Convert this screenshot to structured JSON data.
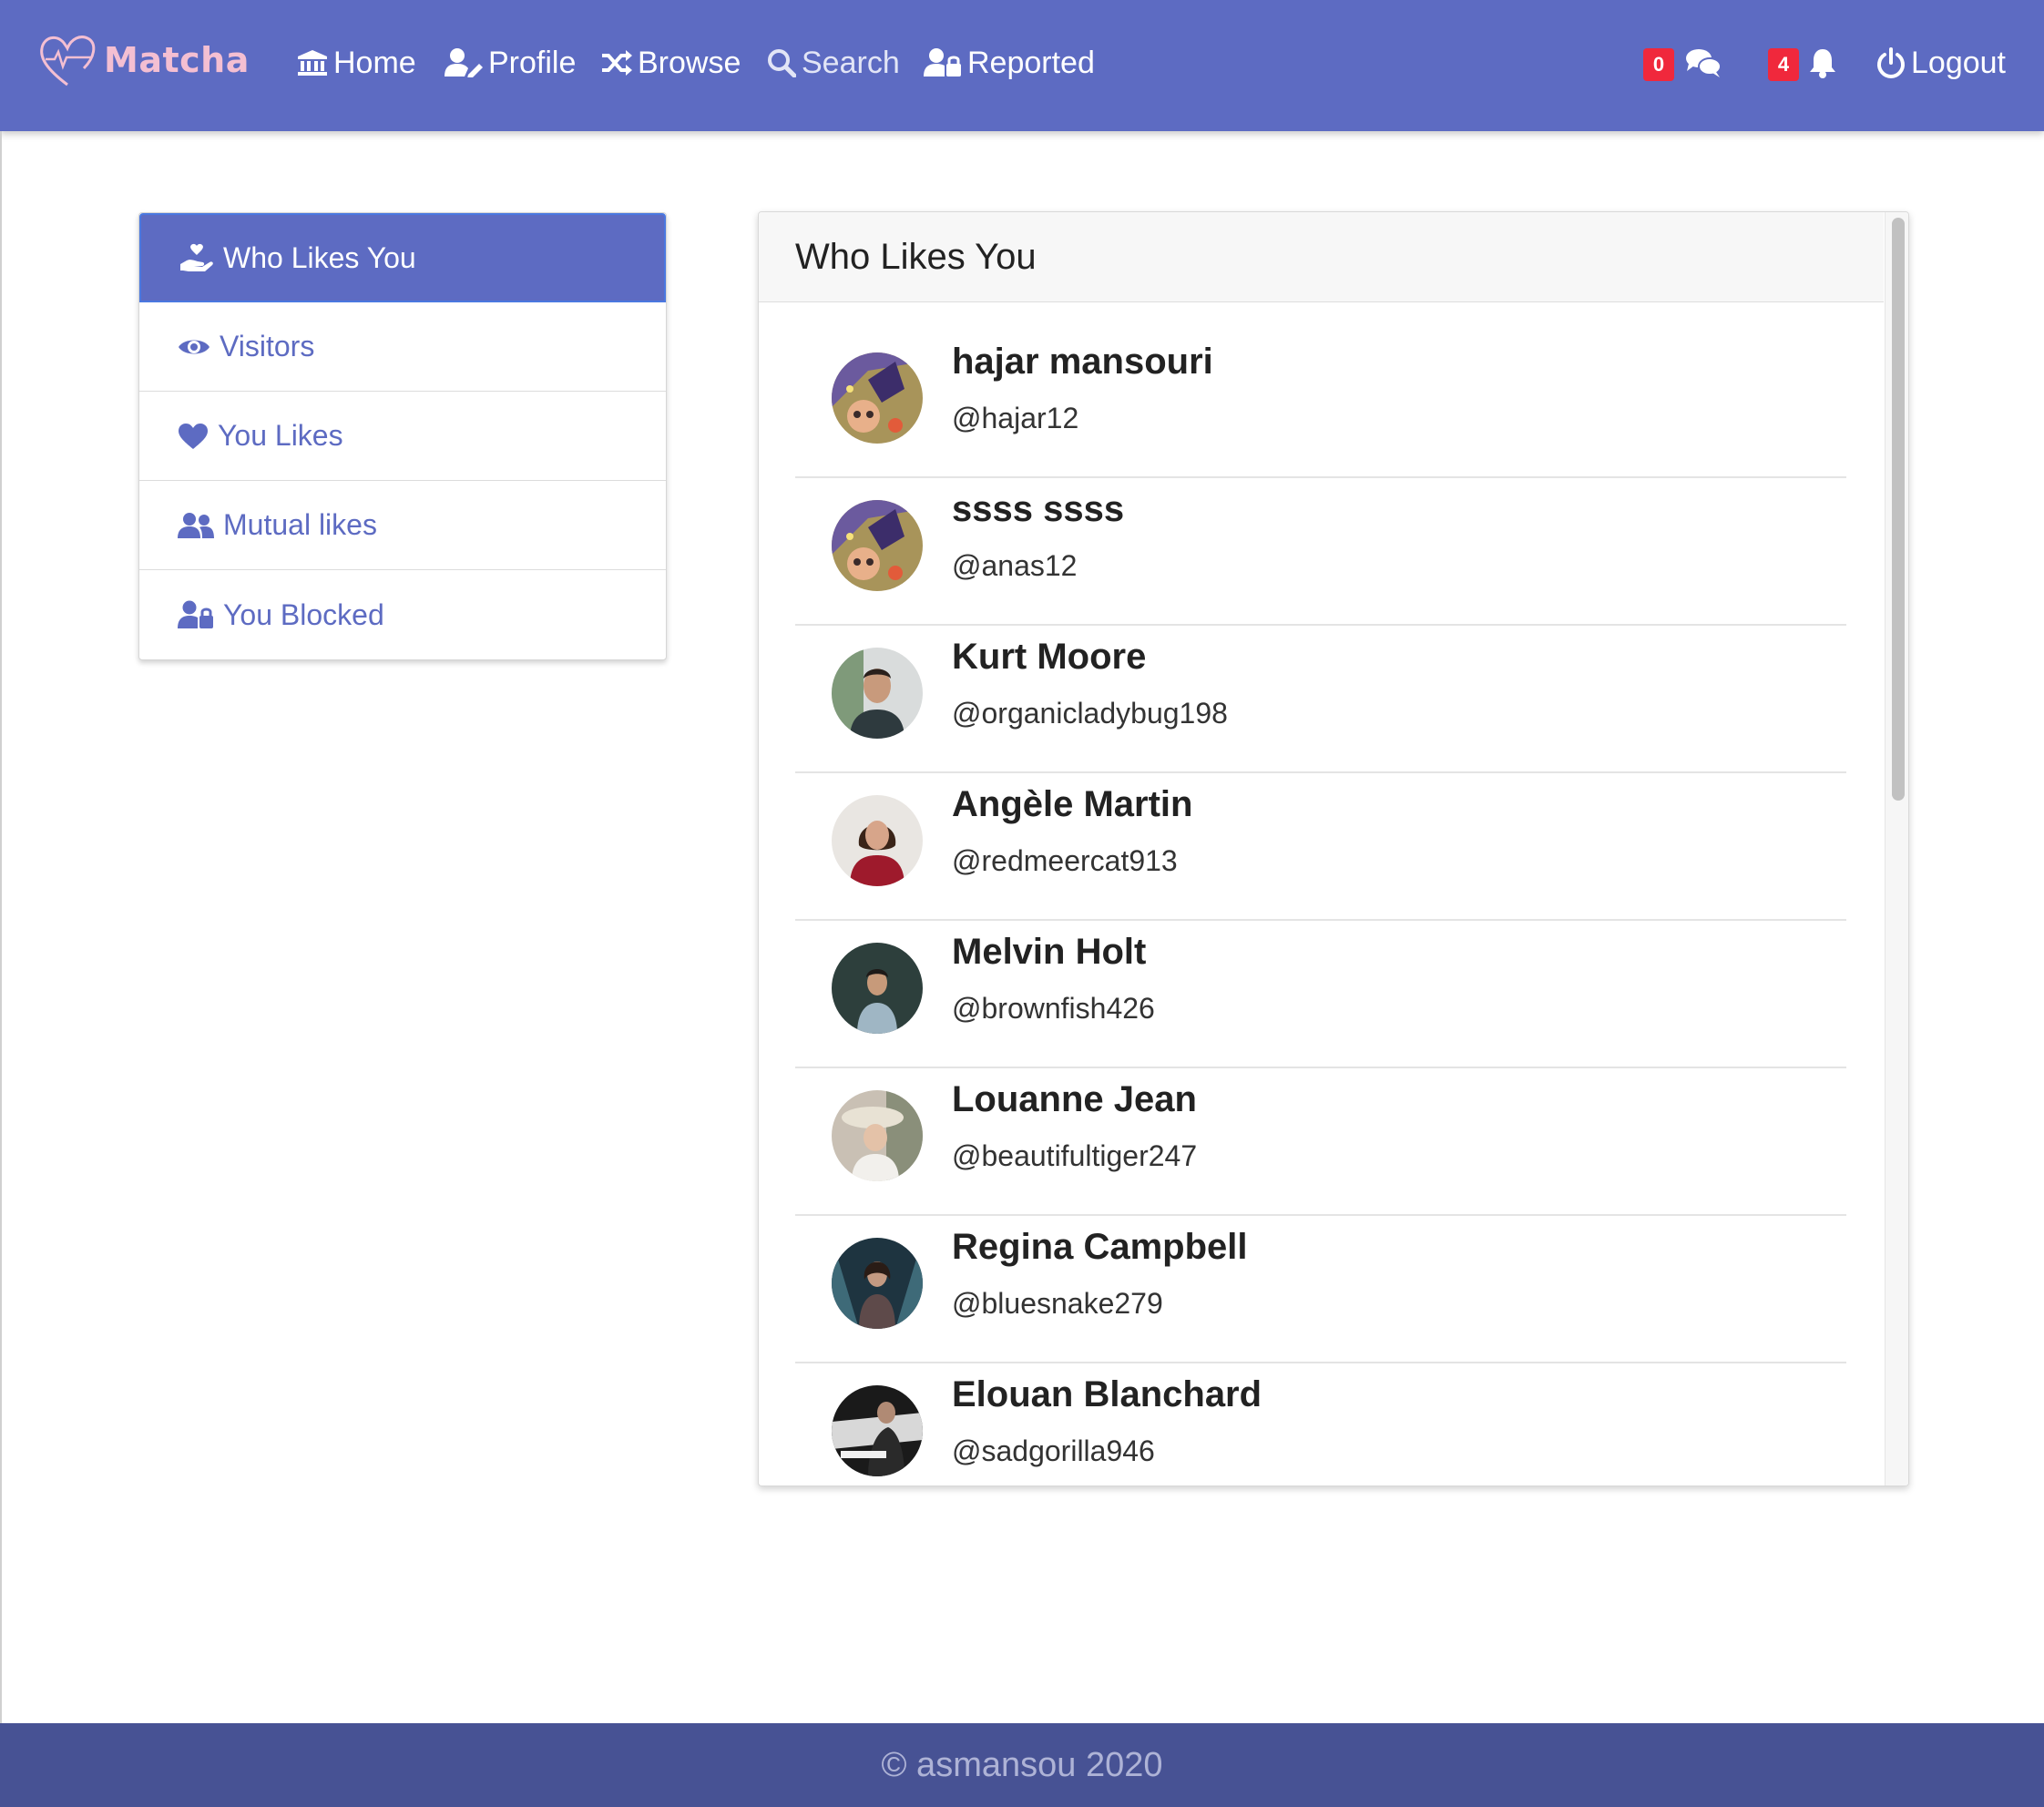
{
  "brand": {
    "name": "Matcha",
    "logo_color": "#f4bfd2"
  },
  "colors": {
    "primary": "#5d6bc2",
    "footer": "#475294",
    "badge": "#f0283c"
  },
  "nav": {
    "home": "Home",
    "profile": "Profile",
    "browse": "Browse",
    "search": "Search",
    "reported": "Reported",
    "messages_count": "0",
    "notifications_count": "4",
    "logout": "Logout"
  },
  "sidebar": {
    "items": [
      {
        "label": "Who Likes You",
        "icon": "hand-holding-heart-icon",
        "active": true
      },
      {
        "label": "Visitors",
        "icon": "eye-icon"
      },
      {
        "label": "You Likes",
        "icon": "heart-icon"
      },
      {
        "label": "Mutual likes",
        "icon": "users-icon"
      },
      {
        "label": "You Blocked",
        "icon": "user-lock-icon"
      }
    ]
  },
  "panel": {
    "title": "Who Likes You",
    "users": [
      {
        "name": "hajar mansouri",
        "username": "@hajar12"
      },
      {
        "name": "ssss ssss",
        "username": "@anas12"
      },
      {
        "name": "Kurt Moore",
        "username": "@organicladybug198"
      },
      {
        "name": "Angèle Martin",
        "username": "@redmeercat913"
      },
      {
        "name": "Melvin Holt",
        "username": "@brownfish426"
      },
      {
        "name": "Louanne Jean",
        "username": "@beautifultiger247"
      },
      {
        "name": "Regina Campbell",
        "username": "@bluesnake279"
      },
      {
        "name": "Elouan Blanchard",
        "username": "@sadgorilla946"
      }
    ]
  },
  "footer": {
    "text": "© asmansou 2020"
  }
}
